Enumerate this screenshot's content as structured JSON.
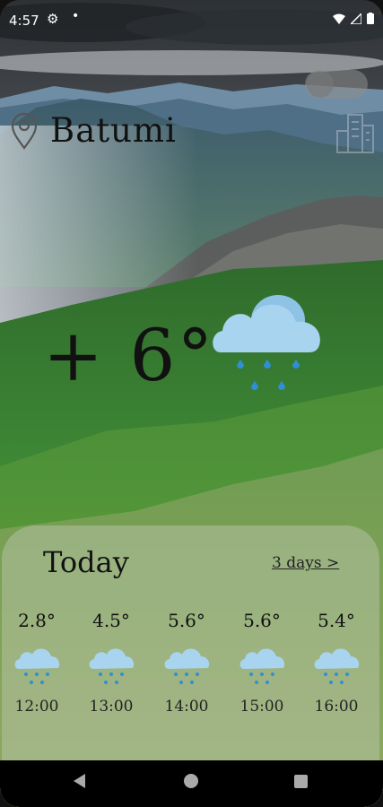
{
  "status_bar": {
    "time": "4:57",
    "icons": [
      "gear-icon",
      "dot-icon",
      "wifi-icon",
      "signal-icon",
      "battery-icon"
    ]
  },
  "header": {
    "city": "Batumi",
    "location_icon": "location-pin-icon",
    "city_icon": "city-buildings-icon",
    "theme_toggle": "toggle"
  },
  "current": {
    "temperature": "+ 6°",
    "condition_icon": "rain-cloud-icon"
  },
  "forecast": {
    "title": "Today",
    "link_label": "3 days >",
    "hours": [
      {
        "temp": "2.8°",
        "time": "12:00",
        "icon": "rain-cloud-icon"
      },
      {
        "temp": "4.5°",
        "time": "13:00",
        "icon": "rain-cloud-icon"
      },
      {
        "temp": "5.6°",
        "time": "14:00",
        "icon": "rain-cloud-icon"
      },
      {
        "temp": "5.6°",
        "time": "15:00",
        "icon": "rain-cloud-icon"
      },
      {
        "temp": "5.4°",
        "time": "16:00",
        "icon": "rain-cloud-icon"
      }
    ]
  },
  "colors": {
    "cloud": "#a9d4ef",
    "rain": "#2f8fd6",
    "panel": "#bec8b4"
  },
  "navbar": {
    "buttons": [
      "back-button",
      "home-button",
      "recents-button"
    ]
  }
}
